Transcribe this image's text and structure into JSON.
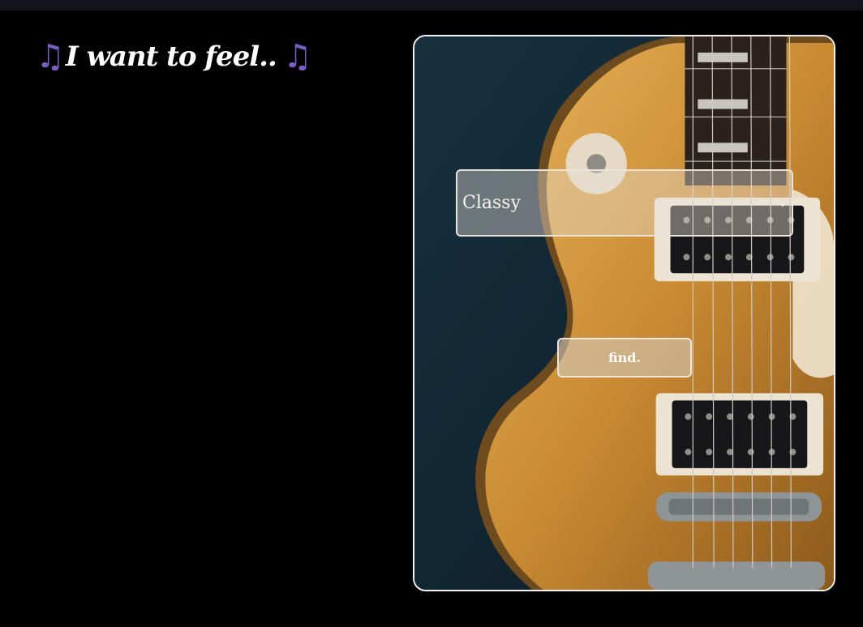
{
  "header": {
    "title": "I want to feel..",
    "note_left": "♫",
    "note_right": "♫"
  },
  "form": {
    "mood_select": {
      "selected": "Classy",
      "chevron": "⌄"
    },
    "find_label": "find."
  },
  "colors": {
    "background": "#000000",
    "topbar": "#13141c",
    "note_accent": "#7a5fc4",
    "card_border": "#f2f2f2"
  },
  "icons": {
    "note": "music-note-icon",
    "dropdown": "chevron-down-icon"
  }
}
